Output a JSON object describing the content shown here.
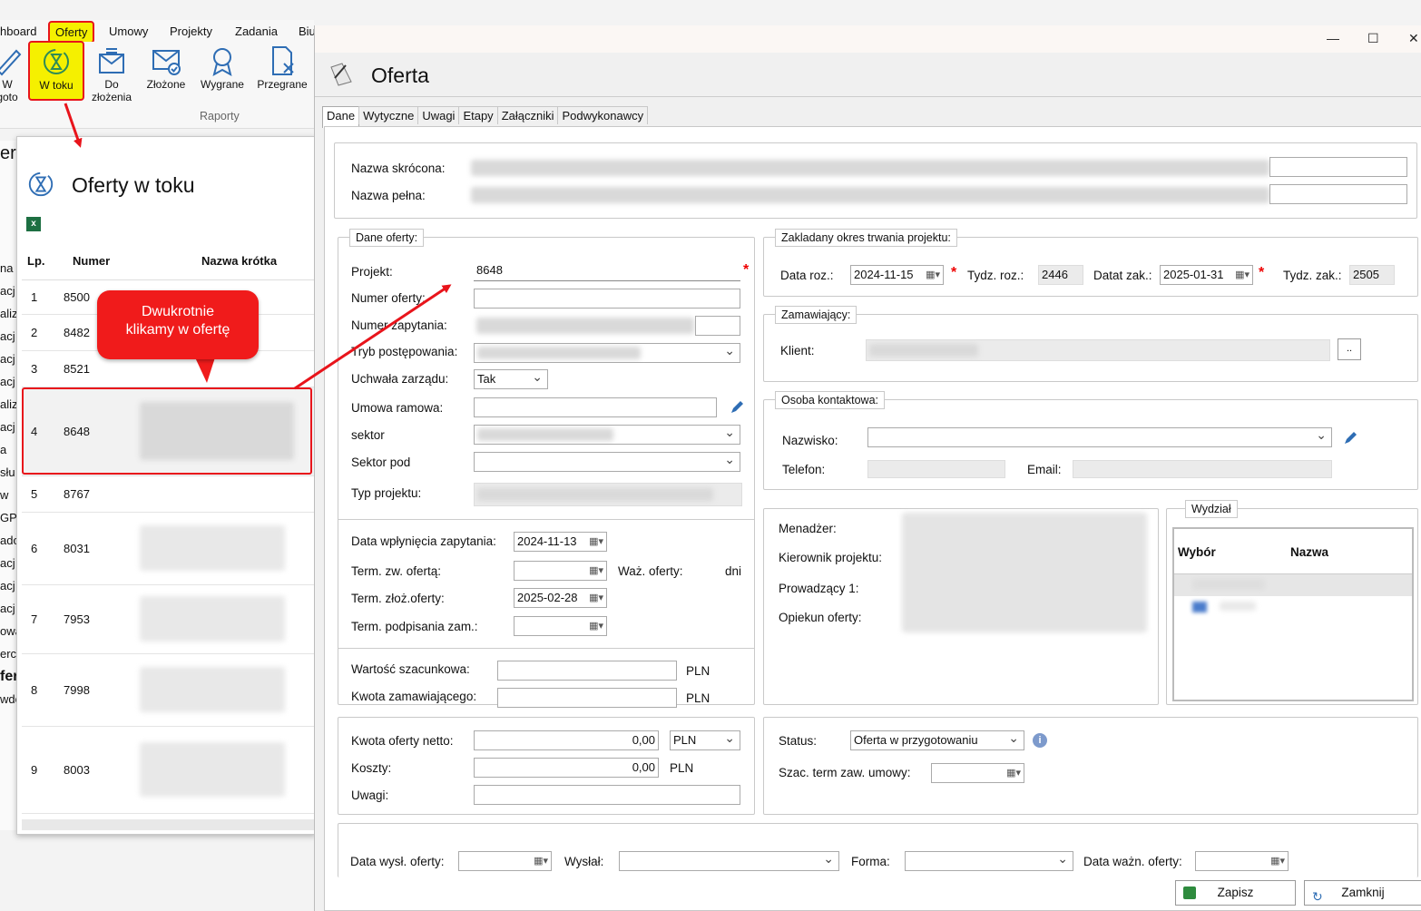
{
  "menubar": {
    "items": [
      "hboard",
      "Oferty",
      "Umowy",
      "Projekty",
      "Zadania",
      "Biu"
    ]
  },
  "ribbon": {
    "buttons": [
      {
        "line1": "W",
        "line2": "goto"
      },
      {
        "line1": "W toku",
        "line2": ""
      },
      {
        "line1": "Do",
        "line2": "złożenia"
      },
      {
        "line1": "Złożone",
        "line2": ""
      },
      {
        "line1": "Wygrane",
        "line2": ""
      },
      {
        "line1": "Przegrane",
        "line2": ""
      }
    ],
    "group_label": "Raporty"
  },
  "list_window": {
    "title": "Oferty w toku",
    "columns": [
      "Lp.",
      "Numer",
      "Nazwa krótka"
    ],
    "rows": [
      {
        "lp": "1",
        "numer": "8500"
      },
      {
        "lp": "2",
        "numer": "8482"
      },
      {
        "lp": "3",
        "numer": "8521"
      },
      {
        "lp": "4",
        "numer": "8648"
      },
      {
        "lp": "5",
        "numer": "8767"
      },
      {
        "lp": "6",
        "numer": "8031"
      },
      {
        "lp": "7",
        "numer": "7953"
      },
      {
        "lp": "8",
        "numer": "7998"
      },
      {
        "lp": "9",
        "numer": "8003"
      }
    ],
    "left_edge_fragments": [
      "er",
      "na",
      "acj",
      "aliz",
      "acj",
      "acj",
      "acj",
      "aliz",
      "acj",
      "a",
      "słu",
      "w",
      "GPZ",
      "ado",
      "acj",
      "acj",
      "acj",
      "owa",
      "erc",
      "fer",
      "wdo"
    ]
  },
  "callout": {
    "line1": "Dwukrotnie",
    "line2": "klikamy w ofertę"
  },
  "main_window": {
    "title": "Oferta",
    "tabs": [
      "Dane",
      "Wytyczne",
      "Uwagi",
      "Etapy",
      "Załączniki",
      "Podwykonawcy"
    ],
    "top": {
      "nazwa_skrocona_label": "Nazwa skrócona:",
      "nazwa_pelna_label": "Nazwa pełna:"
    },
    "dane_oferty": {
      "legend": "Dane oferty:",
      "projekt_label": "Projekt:",
      "projekt_value": "8648",
      "numer_oferty_label": "Numer oferty:",
      "numer_zapytania_label": "Numer zapytania:",
      "tryb_label": "Tryb postępowania:",
      "uchwala_label": "Uchwała zarządu:",
      "uchwala_value": "Tak",
      "umowa_ramowa_label": "Umowa ramowa:",
      "sektor_label": "sektor",
      "sektor_pod_label": "Sektor pod",
      "typ_projektu_label": "Typ projektu:"
    },
    "daty": {
      "data_wplyniecia_label": "Data wpłynięcia zapytania:",
      "data_wplyniecia_value": "2024-11-13",
      "term_zw_label": "Term. zw. ofertą:",
      "waz_label": "Waż. oferty:",
      "dni_label": "dni",
      "term_zloz_label": "Term. złoż.oferty:",
      "term_zloz_value": "2025-02-28",
      "term_podp_label": "Term. podpisania zam.:"
    },
    "wartosci": {
      "wartosc_label": "Wartość szacunkowa:",
      "kwota_zam_label": "Kwota zamawiającego:",
      "currency": "PLN"
    },
    "okres": {
      "legend": "Zakladany okres trwania projektu:",
      "data_roz_label": "Data roz.:",
      "data_roz_value": "2024-11-15",
      "tydz_roz_label": "Tydz. roz.:",
      "tydz_roz_value": "2446",
      "data_zak_label": "Datat zak.:",
      "data_zak_value": "2025-01-31",
      "tydz_zak_label": "Tydz. zak.:",
      "tydz_zak_value": "2505"
    },
    "zamawiajacy": {
      "legend": "Zamawiający:",
      "klient_label": "Klient:",
      "browse_label": ".."
    },
    "osoba": {
      "legend": "Osoba kontaktowa:",
      "nazwisko_label": "Nazwisko:",
      "telefon_label": "Telefon:",
      "email_label": "Email:"
    },
    "osoby_proj": {
      "menadzer_label": "Menadżer:",
      "kierownik_label": "Kierownik projektu:",
      "prowadzacy_label": "Prowadzący 1:",
      "opiekun_label": "Opiekun oferty:"
    },
    "wydzial": {
      "legend": "Wydział",
      "col_wybor": "Wybór",
      "col_nazwa": "Nazwa"
    },
    "kwoty": {
      "kwota_netto_label": "Kwota oferty netto:",
      "kwota_netto_value": "0,00",
      "kwota_netto_currency": "PLN",
      "koszty_label": "Koszty:",
      "koszty_value": "0,00",
      "koszty_currency": "PLN",
      "uwagi_label": "Uwagi:"
    },
    "status": {
      "status_label": "Status:",
      "status_value": "Oferta w przygotowaniu",
      "szac_label": "Szac. term zaw. umowy:"
    },
    "bottom": {
      "data_wysl_label": "Data wysł. oferty:",
      "wyslal_label": "Wysłał:",
      "forma_label": "Forma:",
      "data_wazn_label": "Data ważn. oferty:"
    },
    "buttons": {
      "zapisz": "Zapisz",
      "zamknij": "Zamknij"
    }
  },
  "colors": {
    "highlight_yellow": "#f5f000",
    "annotation_red": "#e8141b",
    "accent_blue": "#2e6db4"
  }
}
